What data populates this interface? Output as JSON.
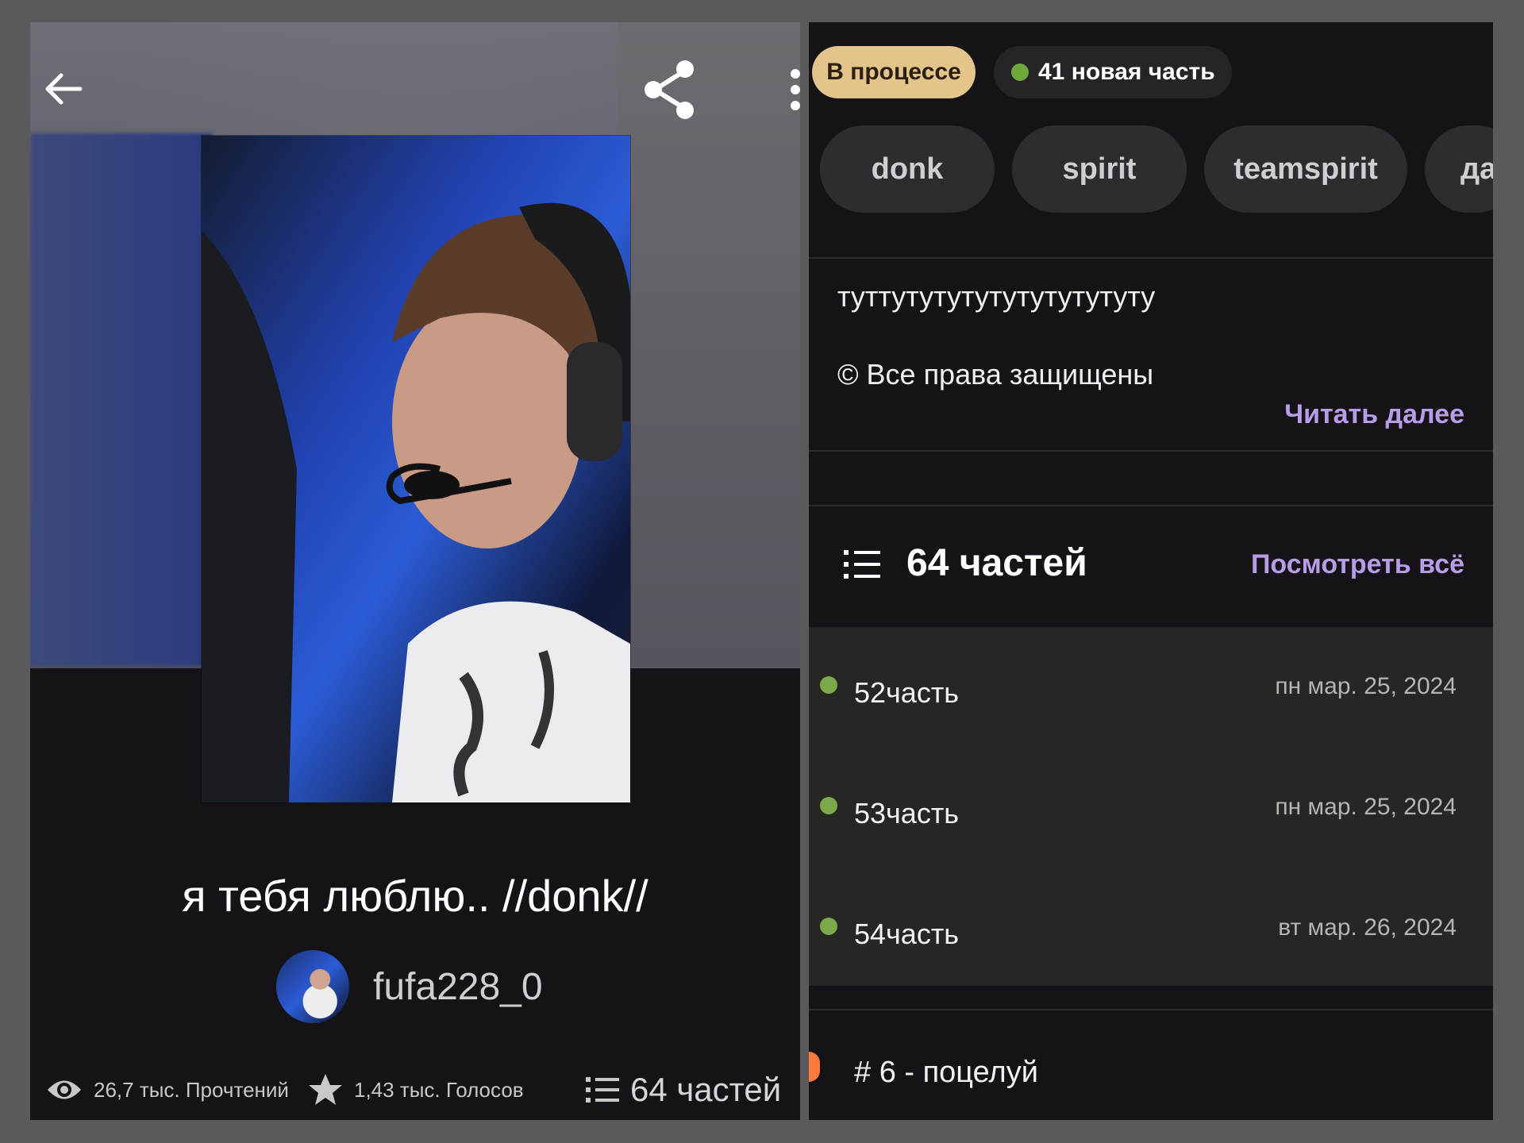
{
  "story": {
    "title": "я тебя люблю.. //donk//",
    "author": "fufa228_0",
    "stats": {
      "reads": "26,7 тыс. Прочтений",
      "votes": "1,43 тыс. Голосов",
      "parts": "64 частей"
    }
  },
  "icons": {
    "back": "arrow-left-icon",
    "share": "share-icon",
    "more": "more-vertical-icon",
    "eye": "eye-icon",
    "star": "star-icon",
    "list": "list-icon"
  },
  "badges": {
    "status": "В процессе",
    "new_part": "41 новая часть"
  },
  "tags": [
    "donk",
    "spirit",
    "teamspirit",
    "да"
  ],
  "description": {
    "text": "туттутутутутутутутутуту",
    "copyright": "© Все права защищены",
    "read_more": "Читать далее"
  },
  "parts_section": {
    "count_label": "64 частей",
    "see_all": "Посмотреть всё",
    "items": [
      {
        "title": "52часть",
        "date": "пн мар. 25, 2024"
      },
      {
        "title": "53часть",
        "date": "пн мар. 25, 2024"
      },
      {
        "title": "54часть",
        "date": "вт мар. 26, 2024"
      }
    ]
  },
  "next_item": {
    "title": "# 6 - поцелуй"
  },
  "colors": {
    "background": "#151318",
    "status_badge": "#e3c48a",
    "accent_link": "#b79ce8",
    "new_dot": "#6fa83a",
    "tag_bg": "#2e2c31"
  }
}
